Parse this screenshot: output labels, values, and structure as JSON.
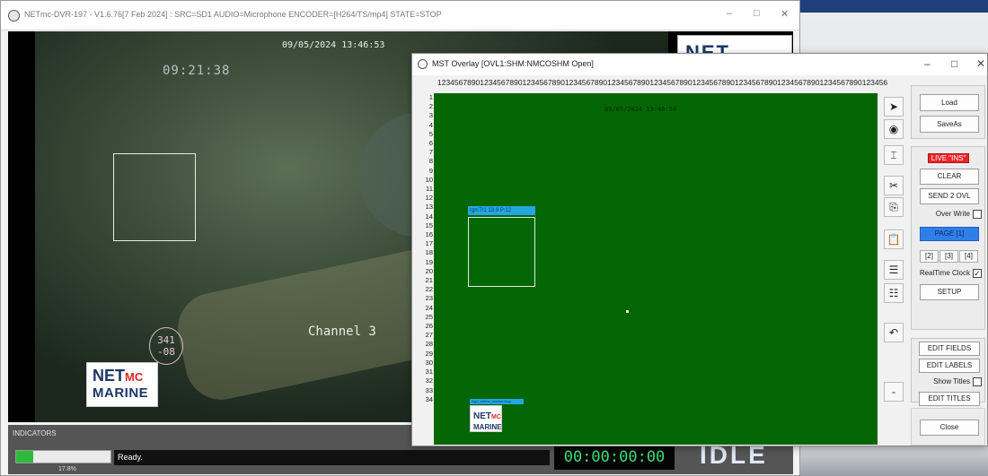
{
  "dvr_window": {
    "title": "NETmc-DVR-197 - V1.6.76[7 Feb 2024] : SRC=SD1 AUDIO=Microphone ENCODER=[H264/TS/mp4] STATE=STOP",
    "minimize": "–",
    "maximize": "□",
    "close": "✕"
  },
  "video": {
    "date": "09/05/2024 13:46:53",
    "timer": "09:21:38",
    "channel": "Channel 3",
    "heading_line1": "341",
    "heading_line2": "-08",
    "logo": {
      "net": "NET",
      "mc": "MC",
      "marine": "MARINE"
    },
    "side_logo": "NET"
  },
  "bottom": {
    "indicators_label": "INDICATORS",
    "progress_percent": 17.8,
    "progress_text": "17.8%",
    "status": "Ready.",
    "timecode": "00:00:00:00",
    "state": "IDLE"
  },
  "overlay_window": {
    "title": "MST Overlay  [OVL1:SHM:NMCOSHM Open]",
    "minimize": "–",
    "maximize": "□",
    "close": "✕",
    "ruler": "1234567890123456789012345678901234567890123456789012345678901234567890123456789012345678901234567890123456",
    "row_numbers": [
      "1",
      "2",
      "3",
      "4",
      "5",
      "6",
      "7",
      "8",
      "9",
      "10",
      "11",
      "12",
      "13",
      "14",
      "15",
      "16",
      "17",
      "18",
      "19",
      "20",
      "21",
      "22",
      "23",
      "24",
      "25",
      "26",
      "27",
      "28",
      "29",
      "30",
      "31",
      "32",
      "33",
      "34"
    ],
    "canvas": {
      "date": "09/05/2024 13:46:54",
      "box_label": "rgn:7/1 13.9 P:12",
      "logo_label": "logo_netmc_marine.bmp",
      "logo": {
        "net": "NET",
        "mc": "MC",
        "marine": "MARINE"
      }
    },
    "tools": [
      {
        "name": "pointer-tool-icon",
        "glyph": "➤"
      },
      {
        "name": "arrow-tool-icon",
        "glyph": "◉"
      },
      {
        "name": "text-tool-icon",
        "glyph": "⌶"
      },
      {
        "name": "cut-icon",
        "glyph": "✂"
      },
      {
        "name": "copy-icon",
        "glyph": "⎘"
      },
      {
        "name": "paste-icon",
        "glyph": "📋"
      },
      {
        "name": "align-top-icon",
        "glyph": "☰"
      },
      {
        "name": "align-bottom-icon",
        "glyph": "☷"
      },
      {
        "name": "undo-icon",
        "glyph": "↶"
      },
      {
        "name": "minus-icon",
        "glyph": "-"
      }
    ],
    "buttons": {
      "load": "Load",
      "save_as": "SaveAs",
      "live": "LIVE \"INS\"",
      "clear": "CLEAR",
      "send_2_ovl": "SEND 2 OVL",
      "over_write": "Over Write",
      "page1": "PAGE [1]",
      "page2": "[2]",
      "page3": "[3]",
      "page4": "[4]",
      "realtime_clock": "RealTime Clock",
      "setup": "SETUP",
      "edit_fields": "EDIT FIELDS",
      "edit_labels": "EDIT LABELS",
      "show_titles": "Show Titles",
      "edit_titles": "EDIT TITLES",
      "close": "Close"
    },
    "checks": {
      "over_write": false,
      "realtime_clock": true,
      "show_titles": false
    },
    "colors": {
      "canvas": "#046604",
      "live": "#e8262c",
      "page_selected": "#2f7fe8"
    }
  }
}
